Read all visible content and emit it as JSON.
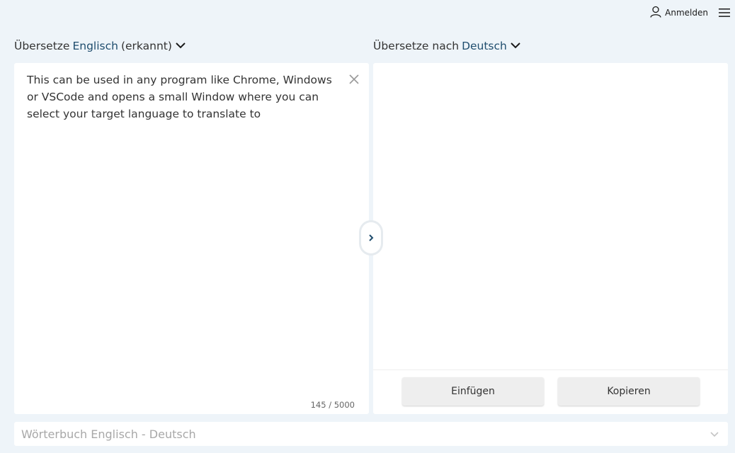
{
  "header": {
    "login_label": "Anmelden",
    "icons": {
      "user": "user-icon",
      "menu": "hamburger-menu-icon"
    }
  },
  "source": {
    "prefix": "Übersetze",
    "language": "Englisch",
    "detected_suffix": "(erkannt)",
    "text": "This can be used in any program like Chrome, Windows or VSCode and opens a small Window where you can select your target language to translate to",
    "char_count": "145 / 5000",
    "icons": {
      "clear": "close-icon",
      "dropdown": "chevron-down-icon"
    }
  },
  "target": {
    "prefix": "Übersetze nach",
    "language": "Deutsch",
    "paste_label": "Einfügen",
    "copy_label": "Kopieren",
    "icons": {
      "dropdown": "chevron-down-icon"
    }
  },
  "swap": {
    "icon": "chevron-right-icon"
  },
  "dictionary": {
    "label": "Wörterbuch Englisch - Deutsch",
    "icon": "chevron-down-icon"
  },
  "colors": {
    "background": "#eef4f9",
    "panel": "#ffffff",
    "accent": "#1f4d6e",
    "text": "#333333",
    "muted": "#a8a8a8",
    "button": "#eeeeee"
  }
}
